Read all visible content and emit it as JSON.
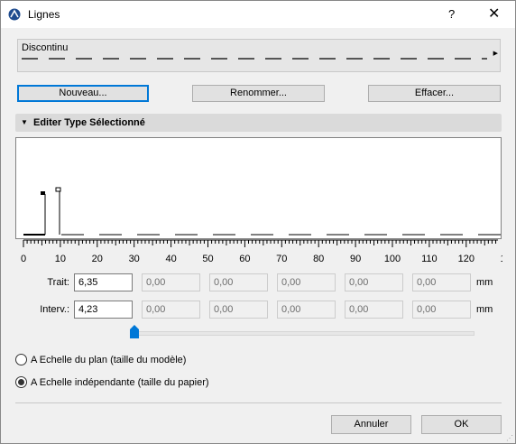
{
  "window": {
    "title": "Lignes",
    "help_label": "?",
    "close_label": "✕"
  },
  "line_type": {
    "name": "Discontinu",
    "arrow": "▶"
  },
  "buttons": {
    "new": "Nouveau...",
    "rename": "Renommer...",
    "delete": "Effacer..."
  },
  "section": {
    "title": "Editer Type Sélectionné"
  },
  "ruler": {
    "labels": [
      "0",
      "10",
      "20",
      "30",
      "40",
      "50",
      "60",
      "70",
      "80",
      "90",
      "100",
      "110",
      "120",
      "1"
    ]
  },
  "dash": {
    "label": "Trait:",
    "values": [
      "6,35",
      "0,00",
      "0,00",
      "0,00",
      "0,00",
      "0,00"
    ],
    "unit": "mm"
  },
  "gap": {
    "label": "Interv.:",
    "values": [
      "4,23",
      "0,00",
      "0,00",
      "0,00",
      "0,00",
      "0,00"
    ],
    "unit": "mm"
  },
  "slider": {
    "value": 0
  },
  "scale": {
    "options": [
      {
        "label": "A Echelle du plan (taille du modèle)",
        "checked": false
      },
      {
        "label": "A Echelle indépendante (taille du papier)",
        "checked": true
      }
    ]
  },
  "footer": {
    "cancel": "Annuler",
    "ok": "OK"
  },
  "colors": {
    "focus": "#0078d7",
    "header_bg": "#dadada",
    "window_bg": "#f0f0f0"
  },
  "icons": {
    "app": "archicad-logo-icon",
    "section_toggle": "triangle-down-icon"
  }
}
